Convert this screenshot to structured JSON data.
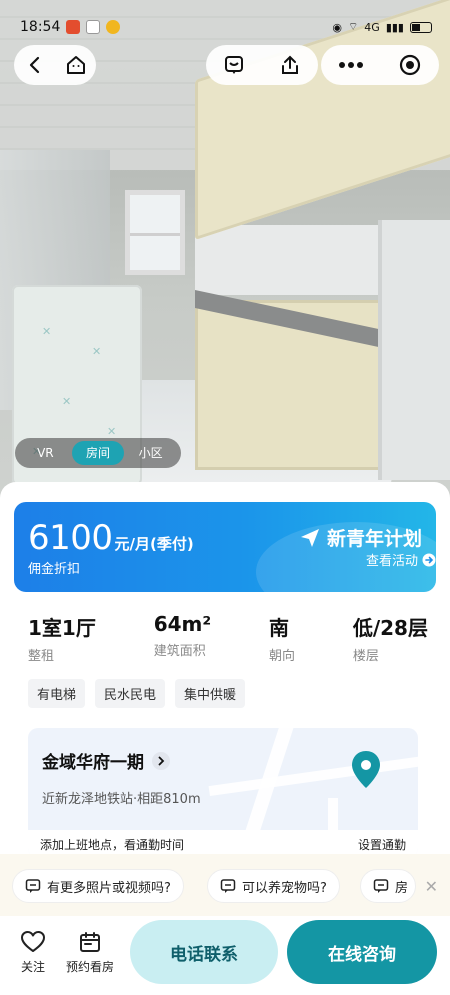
{
  "status_bar": {
    "time": "18:54",
    "network": "4G"
  },
  "nav": {
    "back_icon": "chevron-left-icon",
    "home_icon": "home-icon",
    "message_icon": "message-icon",
    "share_icon": "share-icon",
    "more_icon": "more-dots-icon",
    "target_icon": "record-icon"
  },
  "media_toggle": {
    "tabs": [
      "VR",
      "房间",
      "小区"
    ],
    "active": "房间"
  },
  "price_card": {
    "price": "6100",
    "unit": "元/月(季付)",
    "subtitle": "佣金折扣",
    "promo_title": "新青年计划",
    "promo_link": "查看活动"
  },
  "facts": [
    {
      "value": "1室1厅",
      "label": "整租"
    },
    {
      "value": "64m²",
      "label": "建筑面积"
    },
    {
      "value": "南",
      "label": "朝向"
    },
    {
      "value": "低/28层",
      "label": "楼层"
    }
  ],
  "tags": [
    "有电梯",
    "民水民电",
    "集中供暖"
  ],
  "location": {
    "community": "金域华府一期",
    "metro": "近新龙泽地铁站·相距810m",
    "commute_prompt": "添加上班地点，看通勤时间",
    "commute_action": "设置通勤"
  },
  "quick_questions": [
    "有更多照片或视频吗?",
    "可以养宠物吗?",
    "房"
  ],
  "bottom_bar": {
    "follow_label": "关注",
    "appointment_label": "预约看房",
    "call_label": "电话联系",
    "chat_label": "在线咨询"
  },
  "colors": {
    "accent": "#1496a4",
    "price_blue": "#1d7fe8",
    "light_teal": "#c9eef2"
  }
}
